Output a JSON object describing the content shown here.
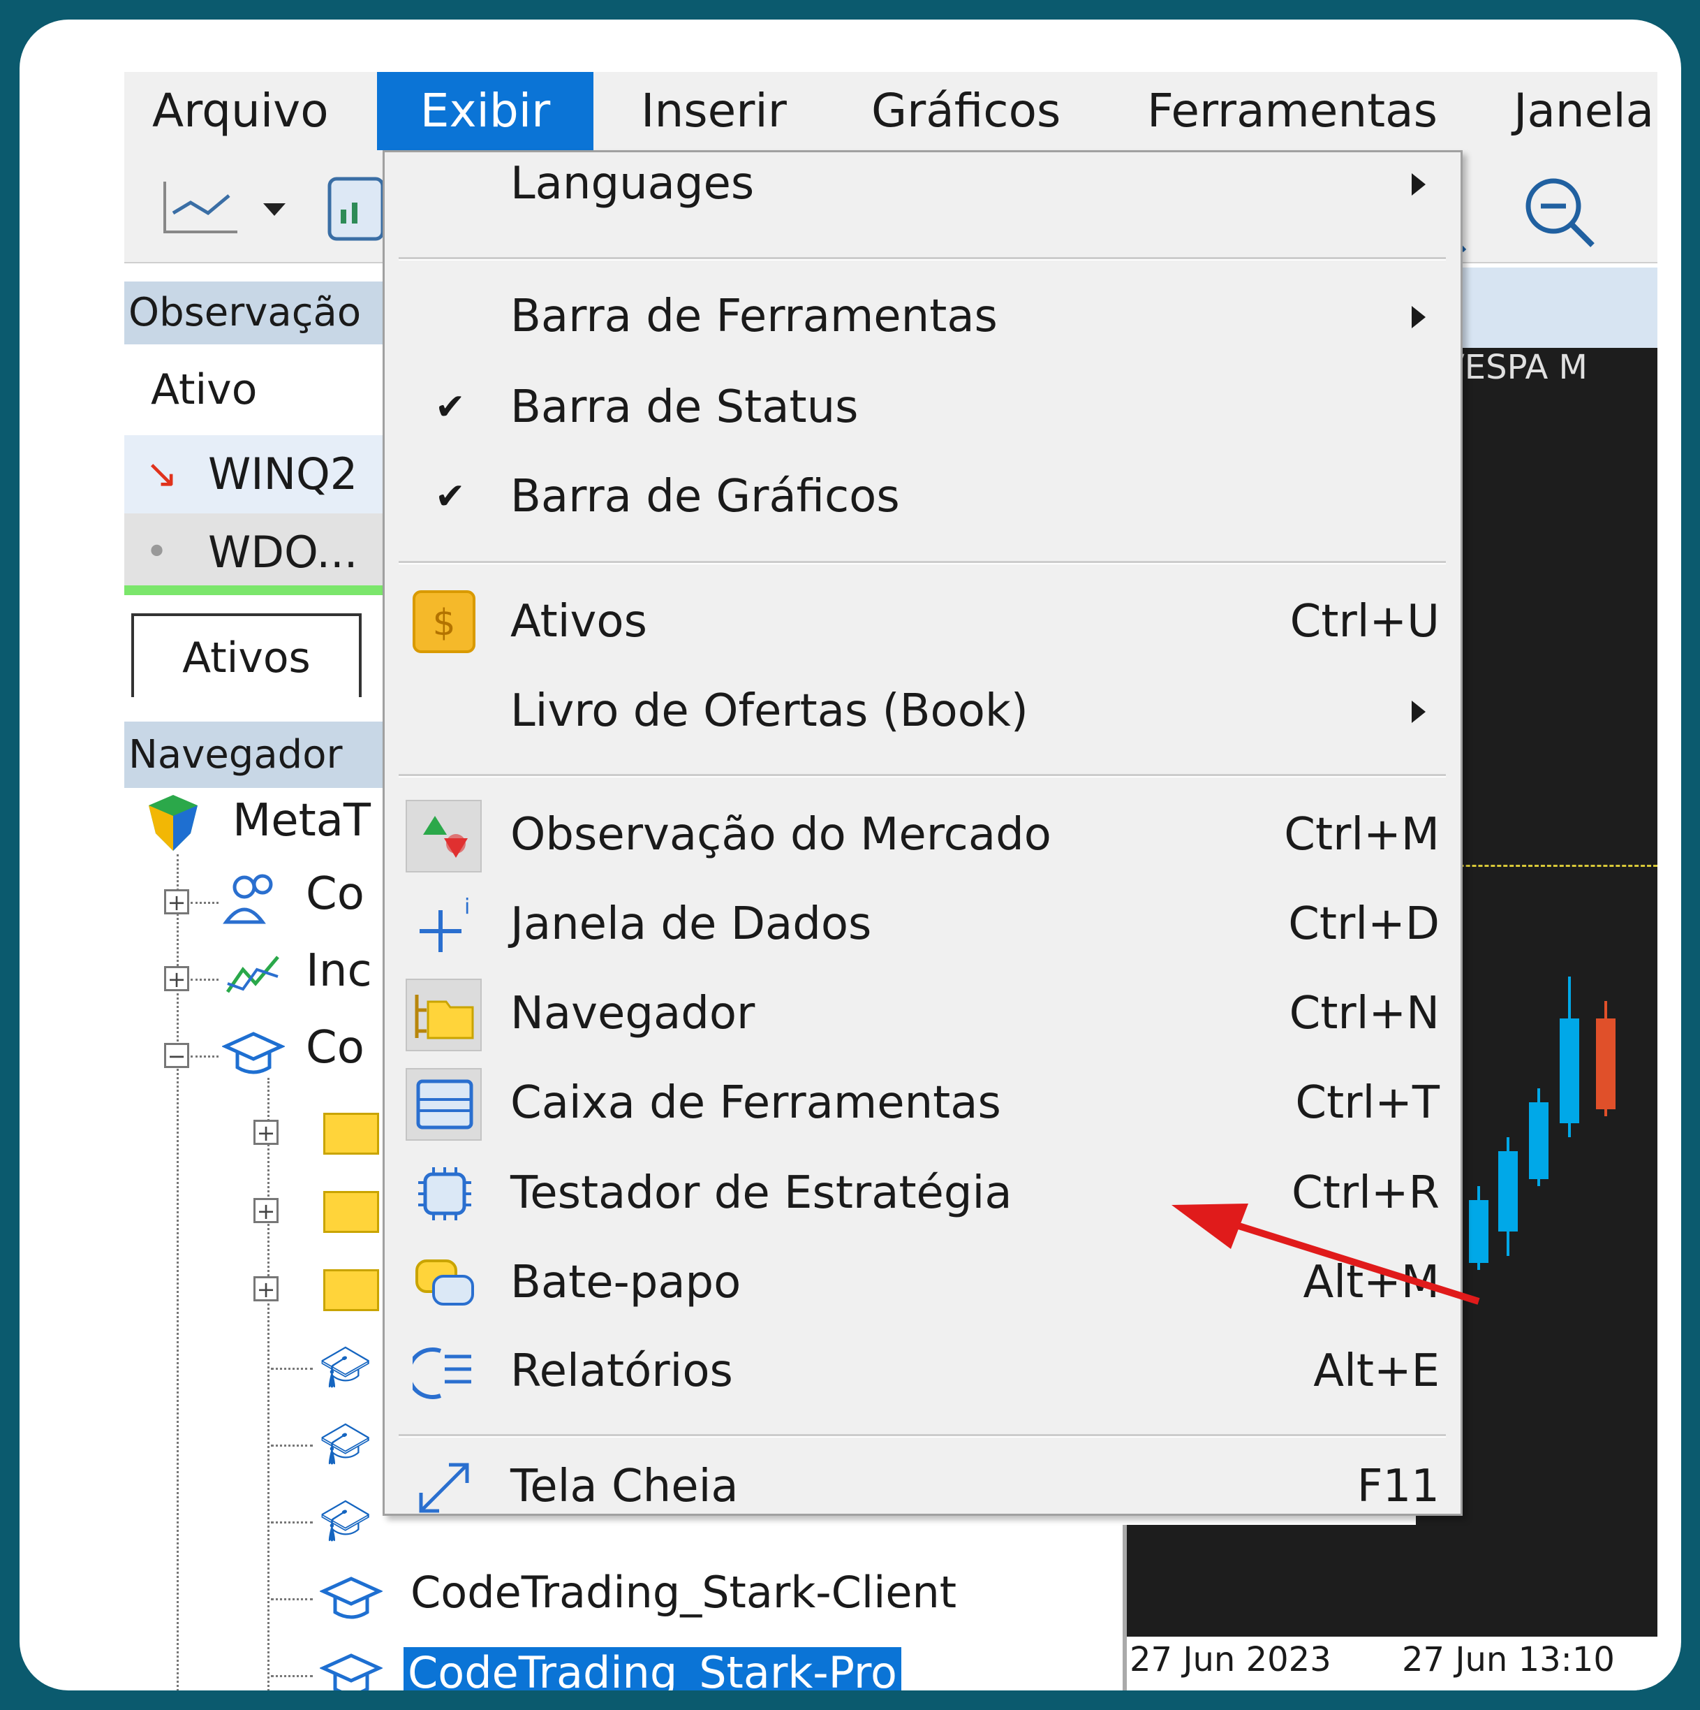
{
  "menubar": {
    "items": [
      {
        "label": "Arquivo"
      },
      {
        "label": "Exibir"
      },
      {
        "label": "Inserir"
      },
      {
        "label": "Gráficos"
      },
      {
        "label": "Ferramentas"
      },
      {
        "label": "Janela"
      }
    ]
  },
  "market_watch": {
    "title": "Observação",
    "column": "Ativo",
    "rows": [
      {
        "symbol": "WINQ2",
        "icon": "arrow-down-icon"
      },
      {
        "symbol": "WDO...",
        "icon": "dot-icon"
      }
    ],
    "tab": "Ativos"
  },
  "navigator": {
    "title": "Navegador",
    "root": "MetaT",
    "children": [
      "Co",
      "Inc",
      "Co"
    ],
    "leaves": [
      "CodeTrading_Stark-Client",
      "CodeTrading_Stark-Pro"
    ]
  },
  "chart": {
    "title": "OVESPA M",
    "dates": [
      "27 Jun 2023",
      "27 Jun 13:10"
    ]
  },
  "view_menu": {
    "items": [
      {
        "label": "Languages",
        "submenu": true
      },
      {
        "label": "Barra de Ferramentas",
        "submenu": true
      },
      {
        "label": "Barra de Status",
        "checked": true
      },
      {
        "label": "Barra de Gráficos",
        "checked": true
      },
      {
        "label": "Ativos",
        "shortcut": "Ctrl+U",
        "icon": "dollar-icon"
      },
      {
        "label": "Livro de Ofertas (Book)",
        "submenu": true
      },
      {
        "label": "Observação do Mercado",
        "shortcut": "Ctrl+M",
        "icon": "market-watch-icon"
      },
      {
        "label": "Janela de Dados",
        "shortcut": "Ctrl+D",
        "icon": "data-window-icon"
      },
      {
        "label": "Navegador",
        "shortcut": "Ctrl+N",
        "icon": "navigator-folder-icon"
      },
      {
        "label": "Caixa de Ferramentas",
        "shortcut": "Ctrl+T",
        "icon": "toolbox-icon"
      },
      {
        "label": "Testador de Estratégia",
        "shortcut": "Ctrl+R",
        "icon": "chip-icon"
      },
      {
        "label": "Bate-papo",
        "shortcut": "Alt+M",
        "icon": "chat-icon"
      },
      {
        "label": "Relatórios",
        "shortcut": "Alt+E",
        "icon": "reports-icon"
      },
      {
        "label": "Tela Cheia",
        "shortcut": "F11",
        "icon": "fullscreen-icon"
      }
    ]
  },
  "colors": {
    "background": "#0b5a6e",
    "menu_highlight": "#0b74d6",
    "annotation_arrow": "#e01b1b"
  }
}
